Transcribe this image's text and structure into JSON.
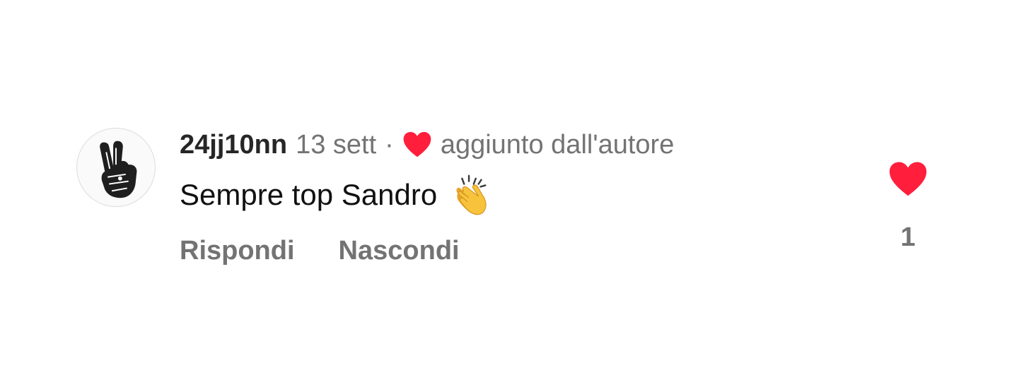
{
  "comment": {
    "username": "24jj10nn",
    "time": "13 sett",
    "separator": "·",
    "author_liked_text": "aggiunto dall'autore",
    "text": "Sempre top Sandro",
    "emoji": "clapping-hands-emoji",
    "actions": {
      "reply_label": "Rispondi",
      "hide_label": "Nascondi"
    },
    "like_count": "1",
    "avatar_icon": "peace-hand-avatar",
    "avatar_lettering": "PEACE LOVE KINDNESS"
  },
  "colors": {
    "heart": "#ff1f3d",
    "username": "#262626",
    "secondary": "#737373",
    "text": "#111111",
    "background": "#ffffff",
    "clap": "#f7c33c"
  }
}
